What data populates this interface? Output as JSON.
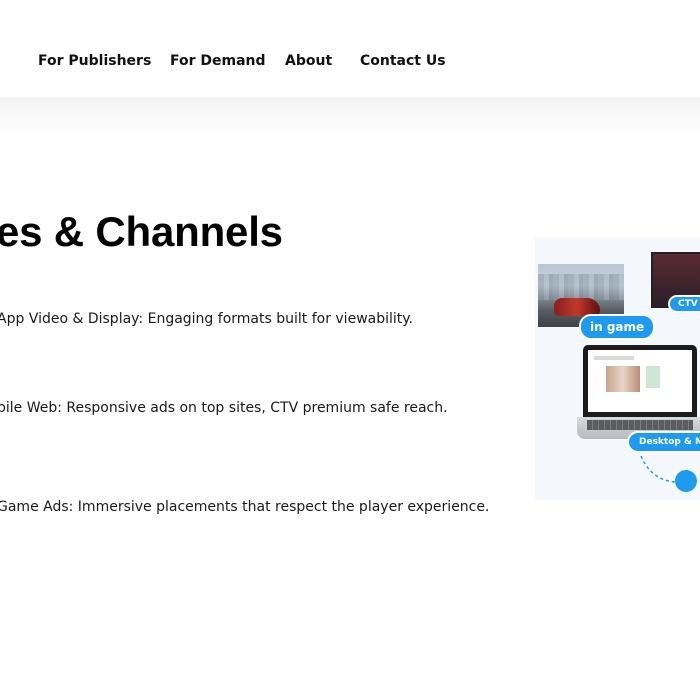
{
  "nav": {
    "items": [
      "For Publishers",
      "For Demand",
      "About",
      "Contact Us"
    ]
  },
  "section": {
    "title": "es & Channels",
    "features": [
      "App Video & Display: Engaging formats built for viewability.",
      "bile Web: Responsive ads on top sites, CTV premium safe reach.",
      "Game Ads: Immersive placements that respect the player experience."
    ]
  },
  "illustration": {
    "badge_ingame": "in game",
    "badge_ctv": "CTV",
    "badge_desktop": "Desktop & Mo"
  },
  "colors": {
    "accent": "#1e9bf0",
    "text": "#111111"
  }
}
